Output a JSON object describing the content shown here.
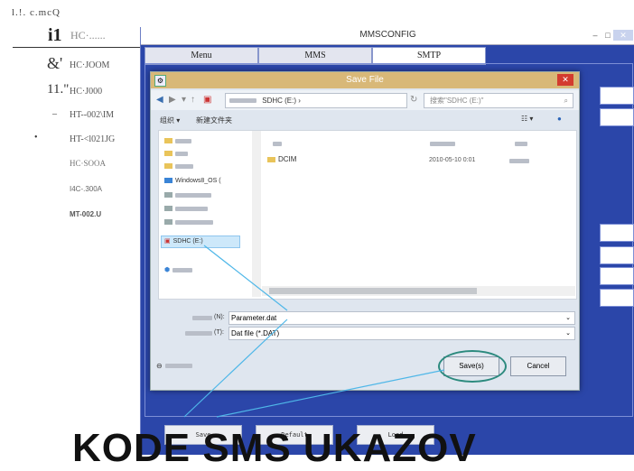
{
  "top_caption": "l.!. c.mcQ",
  "left_panel": {
    "header": "i1",
    "header_rest": "HC·......",
    "items": [
      {
        "bullet": "&'",
        "label": "HC·JOOM"
      },
      {
        "bullet": "11.\"",
        "label": "HC·J000"
      },
      {
        "bullet": "–",
        "label": "HT--002\\IM"
      },
      {
        "bullet": "•",
        "label": "HT-<l021JG"
      },
      {
        "bullet": "",
        "label": "HC·SOOA"
      },
      {
        "bullet": "",
        "label": "I4C-.300A"
      },
      {
        "bullet": "",
        "label": "MT-002.U"
      }
    ]
  },
  "app": {
    "title": "MMSCONFIG",
    "tabs": [
      "Menu",
      "MMS",
      "SMTP"
    ],
    "active_tab": "SMTP",
    "bottom_buttons": [
      "Save",
      "Default",
      "Load"
    ]
  },
  "dialog": {
    "title": "Save File",
    "address_path": "SDHC (E:) ›",
    "search_placeholder": "搜索\"SDHC (E:)\"",
    "toolbar_organize": "组织 ▾",
    "toolbar_new_folder": "新建文件夹",
    "tree": {
      "windows_item": "Windows8_OS (",
      "sdhc_item": "SDHC (E:)"
    },
    "file": {
      "name": "DCIM",
      "date": "2010-05-10 0:01"
    },
    "filename_label": "(N):",
    "filename_value": "Parameter.dat",
    "filetype_label": "(T):",
    "filetype_value": "Dat file (*.DAT)",
    "save_button": "Save(s)",
    "cancel_button": "Cancel"
  },
  "overlay_text": "KODE SMS UKAZOV",
  "colors": {
    "app_background": "#2b46a9",
    "dialog_titlebar": "#d8b878",
    "annotation_circle": "#2c8a7e",
    "annotation_line": "#4fb7e8"
  }
}
